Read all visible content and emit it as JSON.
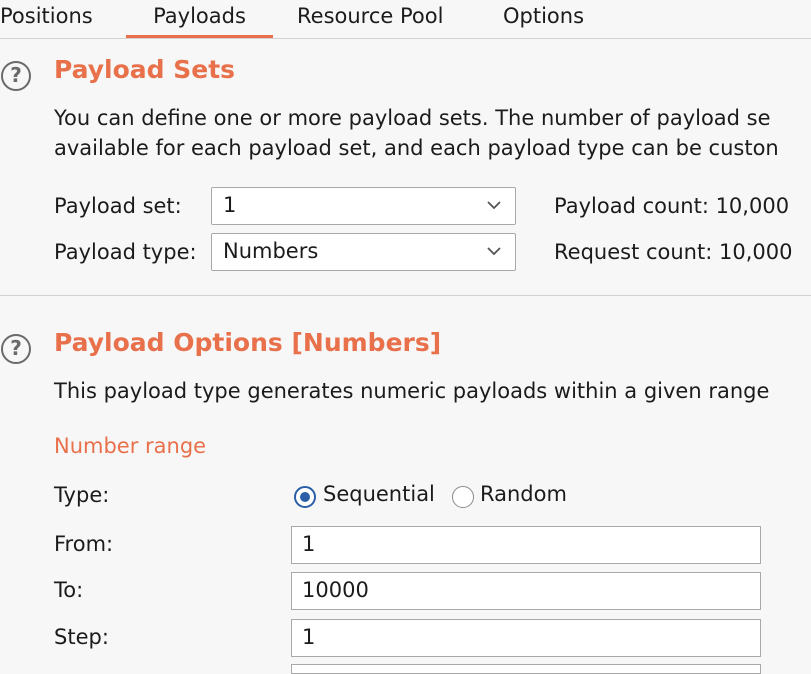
{
  "tabs": [
    {
      "label": "Positions",
      "active": false
    },
    {
      "label": "Payloads",
      "active": true
    },
    {
      "label": "Resource Pool",
      "active": false
    },
    {
      "label": "Options",
      "active": false
    }
  ],
  "payload_sets": {
    "title": "Payload Sets",
    "description_line1": "You can define one or more payload sets. The number of payload se",
    "description_line2": "available for each payload set, and each payload type can be custon",
    "payload_set_label": "Payload set:",
    "payload_set_value": "1",
    "payload_type_label": "Payload type:",
    "payload_type_value": "Numbers",
    "payload_count": "Payload count: 10,000",
    "request_count": "Request count: 10,000"
  },
  "payload_options": {
    "title": "Payload Options [Numbers]",
    "description": "This payload type generates numeric payloads within a given range",
    "section_label": "Number range",
    "type_label": "Type:",
    "type_options": [
      "Sequential",
      "Random"
    ],
    "type_selected": "Sequential",
    "from_label": "From:",
    "from_value": "1",
    "to_label": "To:",
    "to_value": "10000",
    "step_label": "Step:",
    "step_value": "1"
  },
  "colors": {
    "accent": "#e8704a",
    "radio_selected": "#2a5fa8"
  },
  "icons": [
    "help-icon",
    "chevron-down-icon"
  ]
}
